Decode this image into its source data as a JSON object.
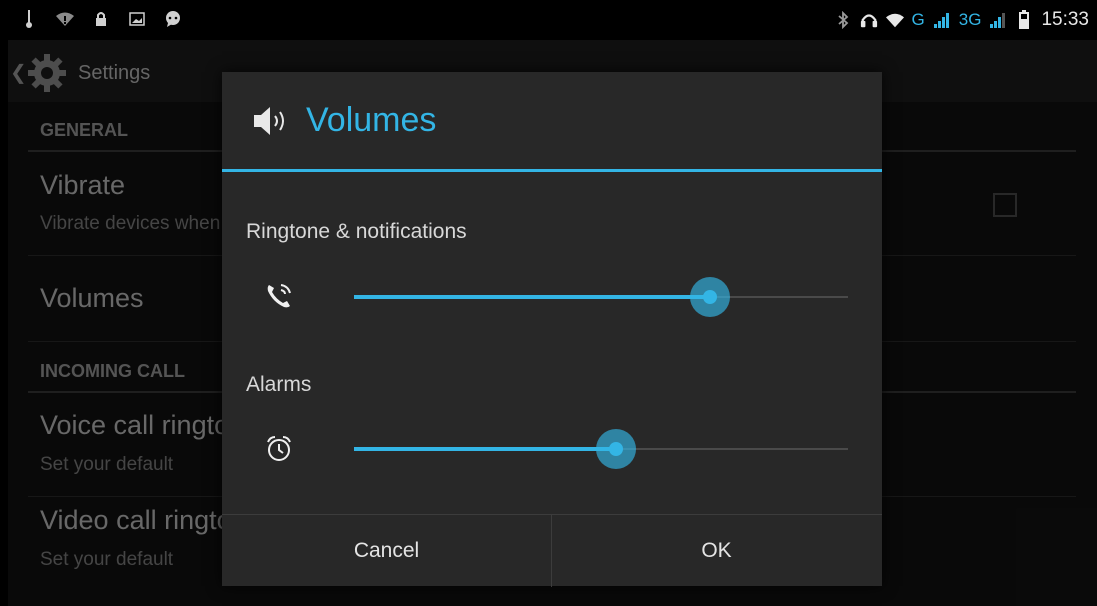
{
  "status_bar": {
    "time": "15:33",
    "network_g": "G",
    "network_3g": "3G",
    "left_icons": [
      "usb-icon",
      "wifi-alert-icon",
      "lock-icon",
      "image-icon",
      "chat-icon"
    ],
    "right_icons": [
      "bluetooth-icon",
      "headset-icon",
      "wifi-icon",
      "signal-icon",
      "signal-icon-2",
      "battery-icon"
    ]
  },
  "background": {
    "app_title": "Settings",
    "sections": [
      {
        "header": "GENERAL"
      },
      {
        "header": "INCOMING CALL"
      }
    ],
    "items": [
      {
        "title": "Vibrate",
        "subtitle": "Vibrate devices when"
      },
      {
        "title": "Volumes"
      },
      {
        "title": "Voice call ringtone",
        "subtitle": "Set your default"
      },
      {
        "title": "Video call ringtone",
        "subtitle": "Set your default"
      }
    ]
  },
  "dialog": {
    "title": "Volumes",
    "title_icon": "speaker-icon",
    "sliders": [
      {
        "label": "Ringtone & notifications",
        "icon": "phone-ring-icon",
        "level_percent": 72
      },
      {
        "label": "Alarms",
        "icon": "alarm-icon",
        "level_percent": 53
      }
    ],
    "cancel_label": "Cancel",
    "ok_label": "OK"
  },
  "colors": {
    "accent": "#33b5e5",
    "dialog_bg": "#282828",
    "screen_bg": "#121212"
  }
}
